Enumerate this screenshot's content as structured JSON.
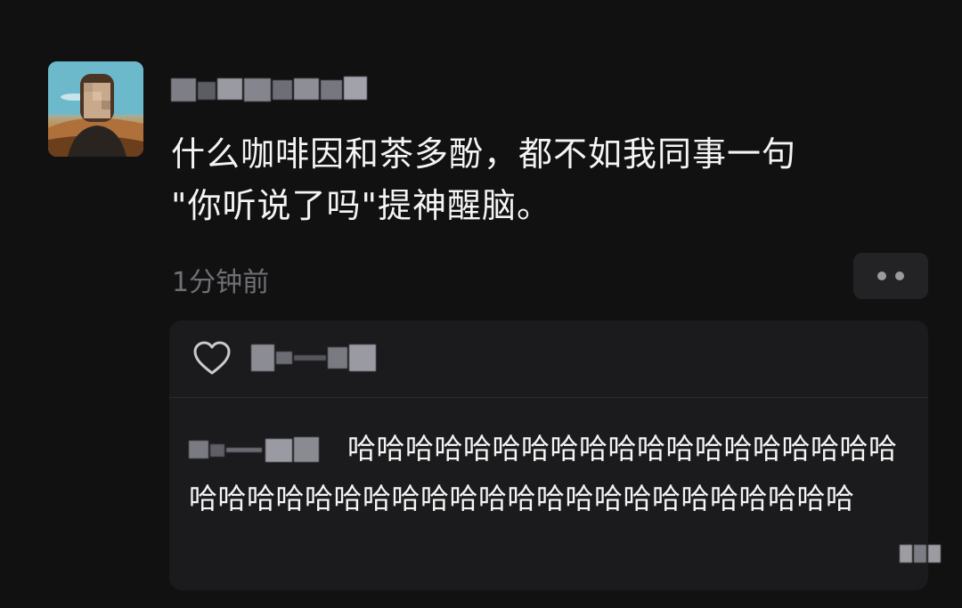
{
  "post": {
    "avatar_icon": "user-avatar-icon",
    "username_redacted": true,
    "text": "什么咖啡因和茶多酚，都不如我同事一句\n\"你听说了吗\"提神醒脑。",
    "timestamp": "1分钟前",
    "more_icon": "more-dots-icon"
  },
  "likes": {
    "icon": "heart-icon",
    "names_redacted": true
  },
  "comment": {
    "author_redacted": true,
    "text": "哈哈哈哈哈哈哈哈哈哈哈哈哈哈哈哈哈哈哈哈哈哈哈哈哈哈哈哈哈哈哈哈哈哈哈哈哈哈哈哈哈哈"
  },
  "colors": {
    "background": "#111112",
    "text": "#f4f4f4",
    "muted": "#6f6f74",
    "comment_panel": "#1b1b1d"
  }
}
